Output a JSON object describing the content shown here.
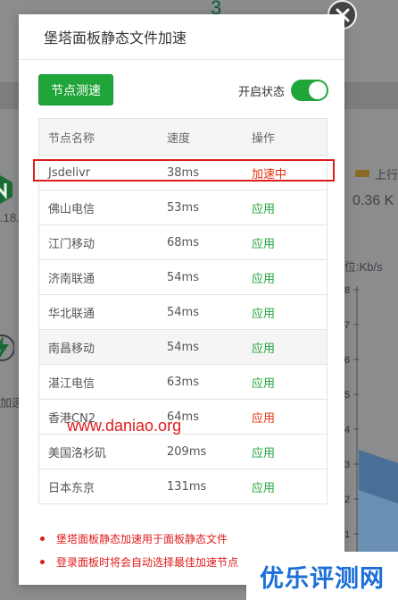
{
  "background": {
    "top_number": "3",
    "version_fragment": ".18.",
    "upstream_label": "上行",
    "upstream_value": "0.36 K",
    "unit_label": "位:Kb/s",
    "accel_fragment": "加速",
    "axis_ticks": [
      "8",
      "7",
      "6",
      "5",
      "4",
      "3",
      "2",
      "1"
    ]
  },
  "modal": {
    "title": "堡塔面板静态文件加速",
    "close_label": "✕",
    "speed_test_button": "节点测速",
    "status_label": "开启状态",
    "toggle_on": true,
    "accent_color": "#20a53a",
    "active_color": "#e3300c"
  },
  "table": {
    "headers": {
      "name": "节点名称",
      "speed": "速度",
      "action": "操作"
    },
    "rows": [
      {
        "name": "Jsdelivr",
        "speed": "38ms",
        "action": "加速中"
      },
      {
        "name": "佛山电信",
        "speed": "53ms",
        "action": "应用"
      },
      {
        "name": "江门移动",
        "speed": "68ms",
        "action": "应用"
      },
      {
        "name": "济南联通",
        "speed": "54ms",
        "action": "应用"
      },
      {
        "name": "华北联通",
        "speed": "54ms",
        "action": "应用"
      },
      {
        "name": "南昌移动",
        "speed": "54ms",
        "action": "应用"
      },
      {
        "name": "湛江电信",
        "speed": "63ms",
        "action": "应用"
      },
      {
        "name": "香港CN2",
        "speed": "64ms",
        "action": "应用"
      },
      {
        "name": "美国洛杉矶",
        "speed": "209ms",
        "action": "应用"
      },
      {
        "name": "日本东京",
        "speed": "131ms",
        "action": "应用"
      }
    ]
  },
  "notes": [
    "堡塔面板静态加速用于面板静态文件",
    "登录面板时将会自动选择最佳加速节点"
  ],
  "watermark": "www.daniao.org",
  "brand": "优乐评测网"
}
